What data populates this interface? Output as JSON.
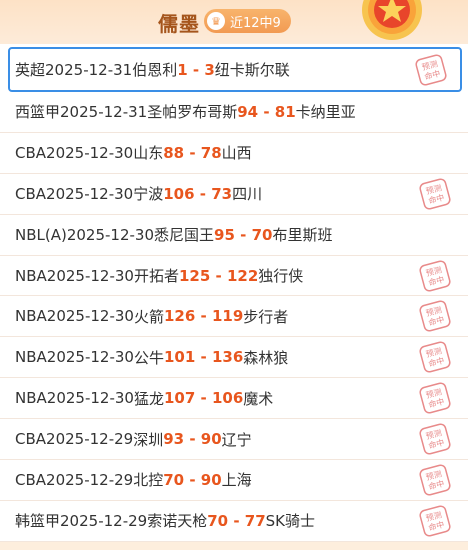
{
  "header": {
    "title": "儒墨",
    "badge_label": "近12中9"
  },
  "matches": [
    {
      "league": "英超",
      "date": "2025-12-31",
      "home": "伯恩利",
      "score": "1 - 3",
      "away": "纽卡斯尔联",
      "stamp": true,
      "active": true
    },
    {
      "league": "西篮甲",
      "date": "2025-12-31",
      "home": "圣帕罗布哥斯",
      "score": "94 - 81",
      "away": "卡纳里亚",
      "stamp": false,
      "active": false
    },
    {
      "league": "CBA",
      "date": "2025-12-30",
      "home": "山东",
      "score": "88 - 78",
      "away": "山西",
      "stamp": false,
      "active": false
    },
    {
      "league": "CBA",
      "date": "2025-12-30",
      "home": "宁波",
      "score": "106 - 73",
      "away": "四川",
      "stamp": true,
      "active": false
    },
    {
      "league": "NBL(A)",
      "date": "2025-12-30",
      "home": "悉尼国王",
      "score": "95 - 70",
      "away": "布里斯班",
      "stamp": false,
      "active": false
    },
    {
      "league": "NBA",
      "date": "2025-12-30",
      "home": "开拓者",
      "score": "125 - 122",
      "away": "独行侠",
      "stamp": true,
      "active": false
    },
    {
      "league": "NBA",
      "date": "2025-12-30",
      "home": "火箭",
      "score": "126 - 119",
      "away": "步行者",
      "stamp": true,
      "active": false
    },
    {
      "league": "NBA",
      "date": "2025-12-30",
      "home": "公牛",
      "score": "101 - 136",
      "away": "森林狼",
      "stamp": true,
      "active": false
    },
    {
      "league": "NBA",
      "date": "2025-12-30",
      "home": "猛龙",
      "score": "107 - 106",
      "away": "魔术",
      "stamp": true,
      "active": false
    },
    {
      "league": "CBA",
      "date": "2025-12-29",
      "home": "深圳",
      "score": "93 - 90",
      "away": "辽宁",
      "stamp": true,
      "active": false
    },
    {
      "league": "CBA",
      "date": "2025-12-29",
      "home": "北控",
      "score": "70 - 90",
      "away": "上海",
      "stamp": true,
      "active": false
    },
    {
      "league": "韩篮甲",
      "date": "2025-12-29",
      "home": "索诺天枪",
      "score": "70 - 77",
      "away": "SK骑士",
      "stamp": true,
      "active": false
    }
  ],
  "stamp": {
    "line1": "预测",
    "line2": "命中"
  },
  "colors": {
    "accent": "#e8561e",
    "selected_border": "#3a8ee6",
    "stamp": "#e88a8a",
    "title": "#a5551c"
  },
  "icons": {
    "badge": "crown-icon",
    "medal": "medal-icon",
    "stamp": "hit-stamp-icon"
  }
}
